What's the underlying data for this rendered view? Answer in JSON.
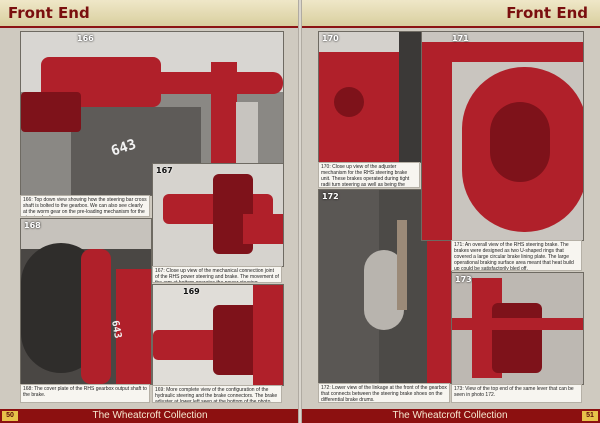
{
  "left_page": {
    "header_title": "Front End",
    "page_number": "50",
    "footer_collection": "The Wheatcroft Collection",
    "photos": [
      {
        "number": "166",
        "caption": "166: Top down view showing how the steering bar cross shaft is bolted to the gearbox. We can also see clearly at the worm gear on the pre-loading mechanism for the steering brakes.",
        "marking": "643"
      },
      {
        "number": "167",
        "caption": "167: Close up view of the mechanical connection joint of the RHS power steering and brake. The movement of the arm at bottom operates the power steering."
      },
      {
        "number": "168",
        "caption": "168: The cover plate of the RHS gearbox output shaft to the brake.",
        "marking": "643"
      },
      {
        "number": "169",
        "caption": "169: More complete view of the configuration of the hydraulic steering and the brake connectors. The brake adjuster at lower left seen at the bottom of the photo."
      }
    ]
  },
  "right_page": {
    "header_title": "Front End",
    "page_number": "51",
    "footer_collection": "The Wheatcroft Collection",
    "photos": [
      {
        "number": "170",
        "caption": "170: Close up view of the adjuster mechanism for the RHS steering brake unit. These brakes operated during tight radii turn steering as well as being the main vehicle brakes."
      },
      {
        "number": "171",
        "caption": "171: An overall view of the RHS steering brake. The brakes were designed as two U-shaped rings that covered a large circular brake lining plate. The large operational braking surface area meant that heat build up could be satisfactorily bled off."
      },
      {
        "number": "172",
        "caption": "172: Lower view of the linkage at the front of the gearbox that connects between the steering brake shoes on the differential brake drums."
      },
      {
        "number": "173",
        "caption": "173: View of the top end of the same lever that can be seen in photo 172."
      }
    ]
  },
  "colors": {
    "header_text": "#7a0f0f",
    "footer_bg": "#8c1010",
    "machine_red": "#b0202a"
  }
}
